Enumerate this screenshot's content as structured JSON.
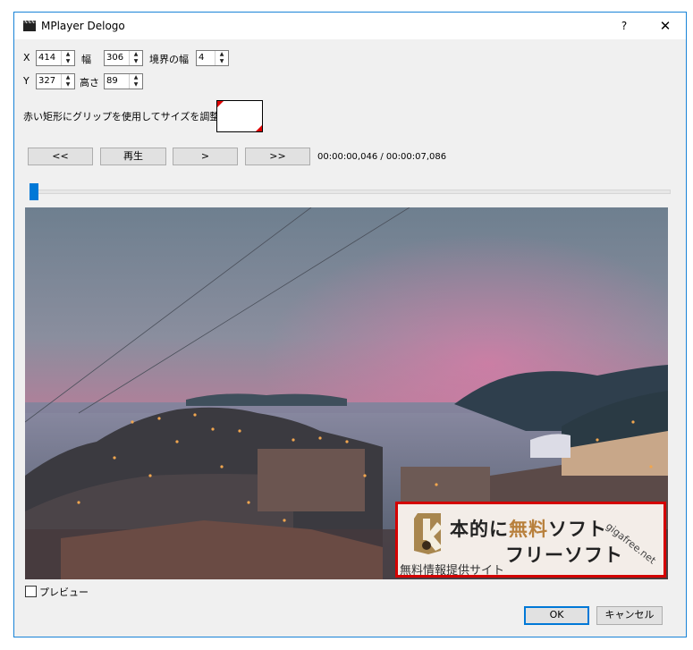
{
  "window": {
    "title": "MPlayer Delogo",
    "help": "?",
    "close": "✕"
  },
  "fields": {
    "x_label": "X",
    "x_value": "414",
    "width_label": "幅",
    "width_value": "306",
    "border_label": "境界の幅",
    "border_value": "4",
    "y_label": "Y",
    "y_value": "327",
    "height_label": "高さ",
    "height_value": "89"
  },
  "grip_hint": "赤い矩形にグリップを使用してサイズを調整",
  "playback": {
    "rewind": "<<",
    "play": "再生",
    "step": ">",
    "forward": ">>",
    "time": "00:00:00,046 / 00:00:07,086",
    "position": 0.0065
  },
  "logo": {
    "line1_a": "本的に",
    "line1_b": "無料",
    "line1_c": "ソフト",
    "line2": "フリーソフト",
    "line3": "無料情報提供サイト",
    "site": "gigafree.net"
  },
  "preview_label": "プレビュー",
  "buttons": {
    "ok": "OK",
    "cancel": "キャンセル"
  },
  "colors": {
    "accent": "#0078d7",
    "grip": "#e00000",
    "logo_border": "#d40000"
  }
}
